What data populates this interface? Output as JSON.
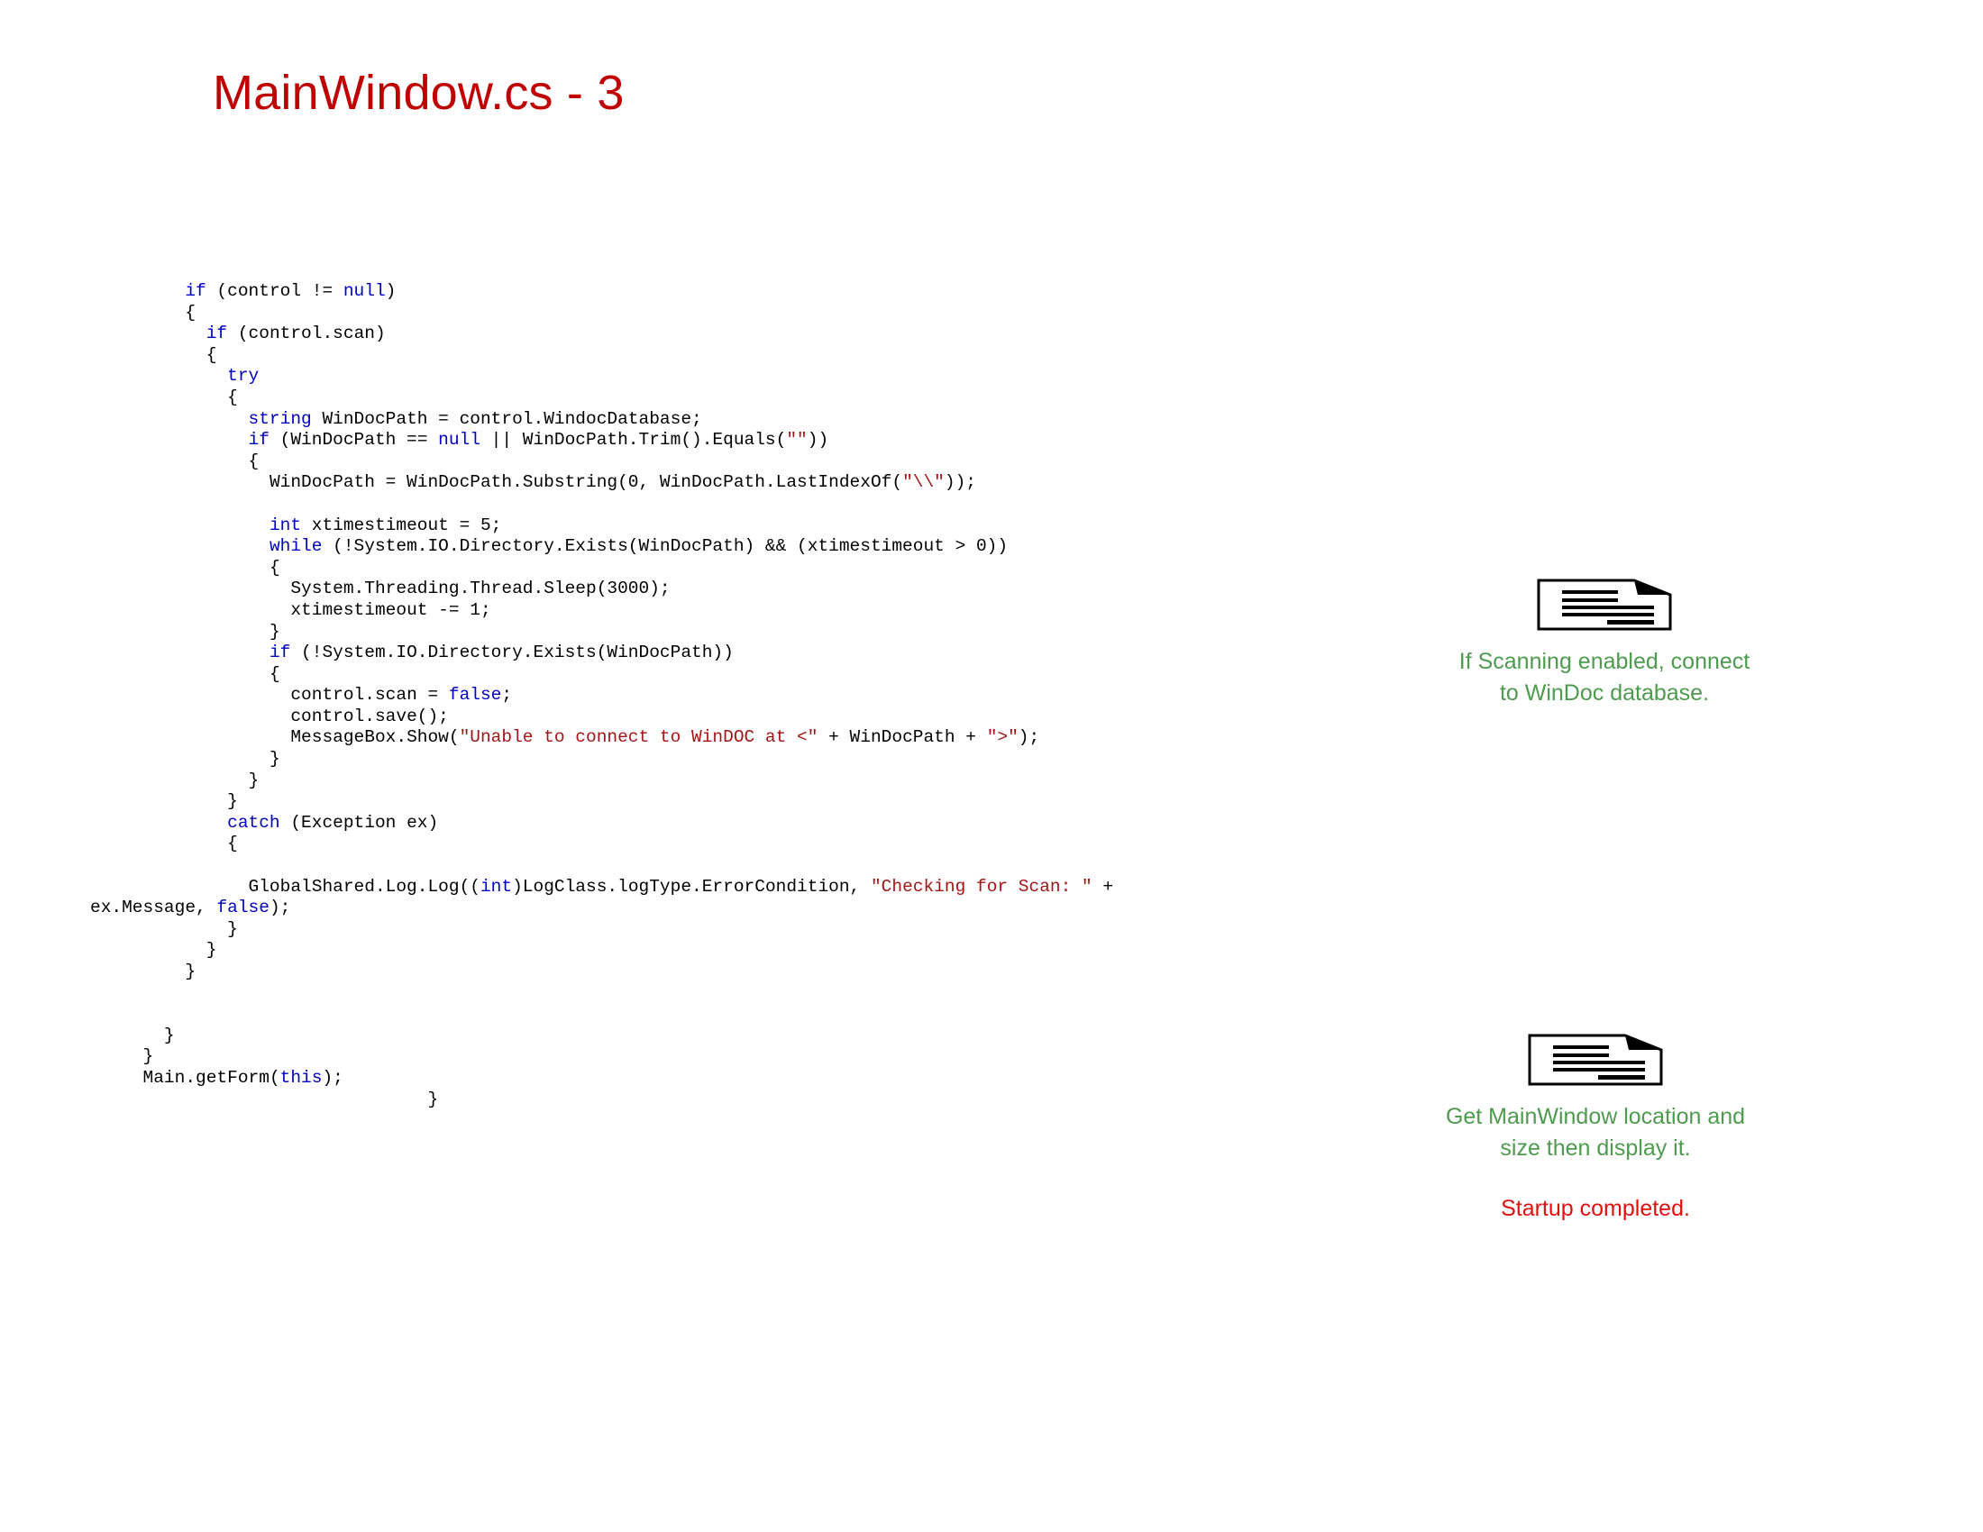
{
  "slide": {
    "title": "MainWindow.cs - 3",
    "title_color": "#C00000"
  },
  "theme": {
    "keyword_color": "#0000C0",
    "string_color": "#A31515",
    "code_color": "#000000",
    "annotation_green": "#4E9A4E",
    "annotation_red": "#E01010",
    "background": "#FFFFFF"
  },
  "code": {
    "language": "csharp",
    "lines": [
      {
        "indent": 9,
        "tokens": [
          {
            "t": "if",
            "c": "kw"
          },
          {
            "t": " (control != ",
            "c": "blk"
          },
          {
            "t": "null",
            "c": "kw"
          },
          {
            "t": ")",
            "c": "blk"
          }
        ]
      },
      {
        "indent": 9,
        "tokens": [
          {
            "t": "{",
            "c": "blk"
          }
        ]
      },
      {
        "indent": 11,
        "tokens": [
          {
            "t": "if",
            "c": "kw"
          },
          {
            "t": " (control.scan)",
            "c": "blk"
          }
        ]
      },
      {
        "indent": 11,
        "tokens": [
          {
            "t": "{",
            "c": "blk"
          }
        ]
      },
      {
        "indent": 13,
        "tokens": [
          {
            "t": "try",
            "c": "kw"
          }
        ]
      },
      {
        "indent": 13,
        "tokens": [
          {
            "t": "{",
            "c": "blk"
          }
        ]
      },
      {
        "indent": 15,
        "tokens": [
          {
            "t": "string",
            "c": "kw"
          },
          {
            "t": " WinDocPath = control.WindocDatabase;",
            "c": "blk"
          }
        ]
      },
      {
        "indent": 15,
        "tokens": [
          {
            "t": "if",
            "c": "kw"
          },
          {
            "t": " (WinDocPath == ",
            "c": "blk"
          },
          {
            "t": "null",
            "c": "kw"
          },
          {
            "t": " || WinDocPath.Trim().Equals(",
            "c": "blk"
          },
          {
            "t": "\"\"",
            "c": "str"
          },
          {
            "t": "))",
            "c": "blk"
          }
        ]
      },
      {
        "indent": 15,
        "tokens": [
          {
            "t": "{",
            "c": "blk"
          }
        ]
      },
      {
        "indent": 17,
        "tokens": [
          {
            "t": "WinDocPath = WinDocPath.Substring(0, WinDocPath.LastIndexOf(",
            "c": "blk"
          },
          {
            "t": "\"\\\\\"",
            "c": "str"
          },
          {
            "t": "));",
            "c": "blk"
          }
        ]
      },
      {
        "indent": 0,
        "tokens": []
      },
      {
        "indent": 17,
        "tokens": [
          {
            "t": "int",
            "c": "kw"
          },
          {
            "t": " xtimestimeout = 5;",
            "c": "blk"
          }
        ]
      },
      {
        "indent": 17,
        "tokens": [
          {
            "t": "while",
            "c": "kw"
          },
          {
            "t": " (!System.IO.Directory.Exists(WinDocPath) && (xtimestimeout > 0))",
            "c": "blk"
          }
        ]
      },
      {
        "indent": 17,
        "tokens": [
          {
            "t": "{",
            "c": "blk"
          }
        ]
      },
      {
        "indent": 19,
        "tokens": [
          {
            "t": "System.Threading.Thread.Sleep(3000);",
            "c": "blk"
          }
        ]
      },
      {
        "indent": 19,
        "tokens": [
          {
            "t": "xtimestimeout -= 1;",
            "c": "blk"
          }
        ]
      },
      {
        "indent": 17,
        "tokens": [
          {
            "t": "}",
            "c": "blk"
          }
        ]
      },
      {
        "indent": 17,
        "tokens": [
          {
            "t": "if",
            "c": "kw"
          },
          {
            "t": " (!System.IO.Directory.Exists(WinDocPath))",
            "c": "blk"
          }
        ]
      },
      {
        "indent": 17,
        "tokens": [
          {
            "t": "{",
            "c": "blk"
          }
        ]
      },
      {
        "indent": 19,
        "tokens": [
          {
            "t": "control.scan = ",
            "c": "blk"
          },
          {
            "t": "false",
            "c": "kw"
          },
          {
            "t": ";",
            "c": "blk"
          }
        ]
      },
      {
        "indent": 19,
        "tokens": [
          {
            "t": "control.save();",
            "c": "blk"
          }
        ]
      },
      {
        "indent": 19,
        "tokens": [
          {
            "t": "MessageBox.Show(",
            "c": "blk"
          },
          {
            "t": "\"Unable to connect to WinDOC at <\"",
            "c": "str"
          },
          {
            "t": " + WinDocPath + ",
            "c": "blk"
          },
          {
            "t": "\">\"",
            "c": "str"
          },
          {
            "t": ");",
            "c": "blk"
          }
        ]
      },
      {
        "indent": 17,
        "tokens": [
          {
            "t": "}",
            "c": "blk"
          }
        ]
      },
      {
        "indent": 15,
        "tokens": [
          {
            "t": "}",
            "c": "blk"
          }
        ]
      },
      {
        "indent": 13,
        "tokens": [
          {
            "t": "}",
            "c": "blk"
          }
        ]
      },
      {
        "indent": 13,
        "tokens": [
          {
            "t": "catch",
            "c": "kw"
          },
          {
            "t": " (Exception ex)",
            "c": "blk"
          }
        ]
      },
      {
        "indent": 13,
        "tokens": [
          {
            "t": "{",
            "c": "blk"
          }
        ]
      },
      {
        "indent": 0,
        "tokens": []
      },
      {
        "indent": 15,
        "tokens": [
          {
            "t": "GlobalShared.Log.Log((",
            "c": "blk"
          },
          {
            "t": "int",
            "c": "kw"
          },
          {
            "t": ")LogClass.logType.ErrorCondition, ",
            "c": "blk"
          },
          {
            "t": "\"Checking for Scan: \"",
            "c": "str"
          },
          {
            "t": " +",
            "c": "blk"
          }
        ]
      },
      {
        "indent": -3,
        "tokens": [
          {
            "t": "ex.Message, ",
            "c": "blk"
          },
          {
            "t": "false",
            "c": "kw"
          },
          {
            "t": ");",
            "c": "blk"
          }
        ]
      },
      {
        "indent": 13,
        "tokens": [
          {
            "t": "}",
            "c": "blk"
          }
        ]
      },
      {
        "indent": 11,
        "tokens": [
          {
            "t": "}",
            "c": "blk"
          }
        ]
      },
      {
        "indent": 9,
        "tokens": [
          {
            "t": "}",
            "c": "blk"
          }
        ]
      },
      {
        "indent": 0,
        "tokens": []
      },
      {
        "indent": 0,
        "tokens": []
      },
      {
        "indent": 7,
        "tokens": [
          {
            "t": "}",
            "c": "blk"
          }
        ]
      },
      {
        "indent": 5,
        "tokens": [
          {
            "t": "}",
            "c": "blk"
          }
        ]
      },
      {
        "indent": 5,
        "tokens": [
          {
            "t": "Main.getForm(",
            "c": "blk"
          },
          {
            "t": "this",
            "c": "kw"
          },
          {
            "t": ");",
            "c": "blk"
          }
        ]
      },
      {
        "indent": 32,
        "tokens": [
          {
            "t": "}",
            "c": "blk"
          }
        ]
      }
    ]
  },
  "callouts": [
    {
      "id": "callout-scan",
      "icon": "document-note-icon",
      "note": "If Scanning enabled, connect\nto WinDoc database.",
      "note_alt": ""
    },
    {
      "id": "callout-window",
      "icon": "document-note-icon",
      "note": "Get MainWindow location and\nsize then display it.",
      "note_alt": "Startup completed."
    }
  ]
}
